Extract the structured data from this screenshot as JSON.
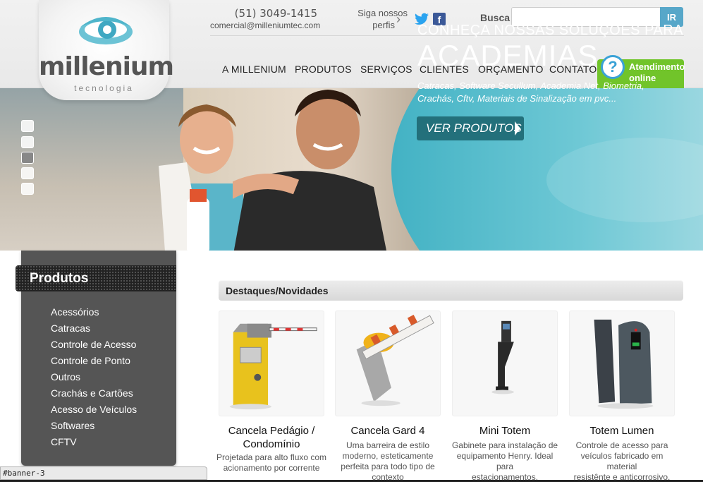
{
  "header": {
    "logo": {
      "name": "millenium",
      "tagline": "tecnologia"
    },
    "contact": {
      "phone": "(51) 3049-1415",
      "email": "comercial@milleniumtec.com"
    },
    "social": {
      "label_line1": "Siga nossos",
      "label_line2": "perfis",
      "icons": [
        "twitter-icon",
        "facebook-icon"
      ]
    },
    "search": {
      "label": "Busca",
      "value": "",
      "placeholder": "",
      "button": "IR"
    },
    "nav": [
      "A MILLENIUM",
      "PRODUTOS",
      "SERVIÇOS",
      "CLIENTES",
      "ORÇAMENTO",
      "CONTATO"
    ],
    "atendimento": {
      "line1": "Atendimento",
      "line2": "online"
    }
  },
  "banner": {
    "kicker": "CONHEÇA NOSSAS SOLUÇÕES PARA",
    "title": "ACADEMIAS",
    "description_line1": "Catracas, Software Secullum, Academia.Net, Biometria,",
    "description_line2": "Crachás, Cftv, Materiais de Sinalização em pvc...",
    "cta": "VER PRODUTOS",
    "slides": 5,
    "active_slide": 3
  },
  "sidebar": {
    "title": "Produtos",
    "items": [
      "Acessórios",
      "Catracas",
      "Controle de Acesso",
      "Controle de Ponto",
      "Outros",
      "Crachás e Cartões",
      "Acesso de Veículos",
      "Softwares",
      "CFTV"
    ]
  },
  "destaques": {
    "title": "Destaques/Novidades",
    "products": [
      {
        "name_line1": "Cancela Pedágio /",
        "name_line2": "Condomínio",
        "desc_line1": "Projetada para alto fluxo com",
        "desc_line2": "acionamento por corrente",
        "desc_line3": ""
      },
      {
        "name_line1": "Cancela Gard 4",
        "name_line2": "",
        "desc_line1": "Uma barreira de estilo",
        "desc_line2": "moderno, esteticamente",
        "desc_line3": "perfeita para todo tipo de",
        "desc_line4": "contexto"
      },
      {
        "name_line1": "Mini Totem",
        "name_line2": "",
        "desc_line1": "Gabinete para instalação de",
        "desc_line2": "equipamento Henry. Ideal para",
        "desc_line3": "estacionamentos."
      },
      {
        "name_line1": "Totem Lumen",
        "name_line2": "",
        "desc_line1": "Controle de acesso para",
        "desc_line2": "veículos fabricado em material",
        "desc_line3": "resistênte e anticorrosivo."
      }
    ]
  },
  "status_bar": {
    "text": "#banner-3"
  },
  "colors": {
    "accent_blue": "#57a7c9",
    "banner_teal": "#4cb8c9",
    "green": "#71c42a",
    "sidebar": "#555555"
  }
}
